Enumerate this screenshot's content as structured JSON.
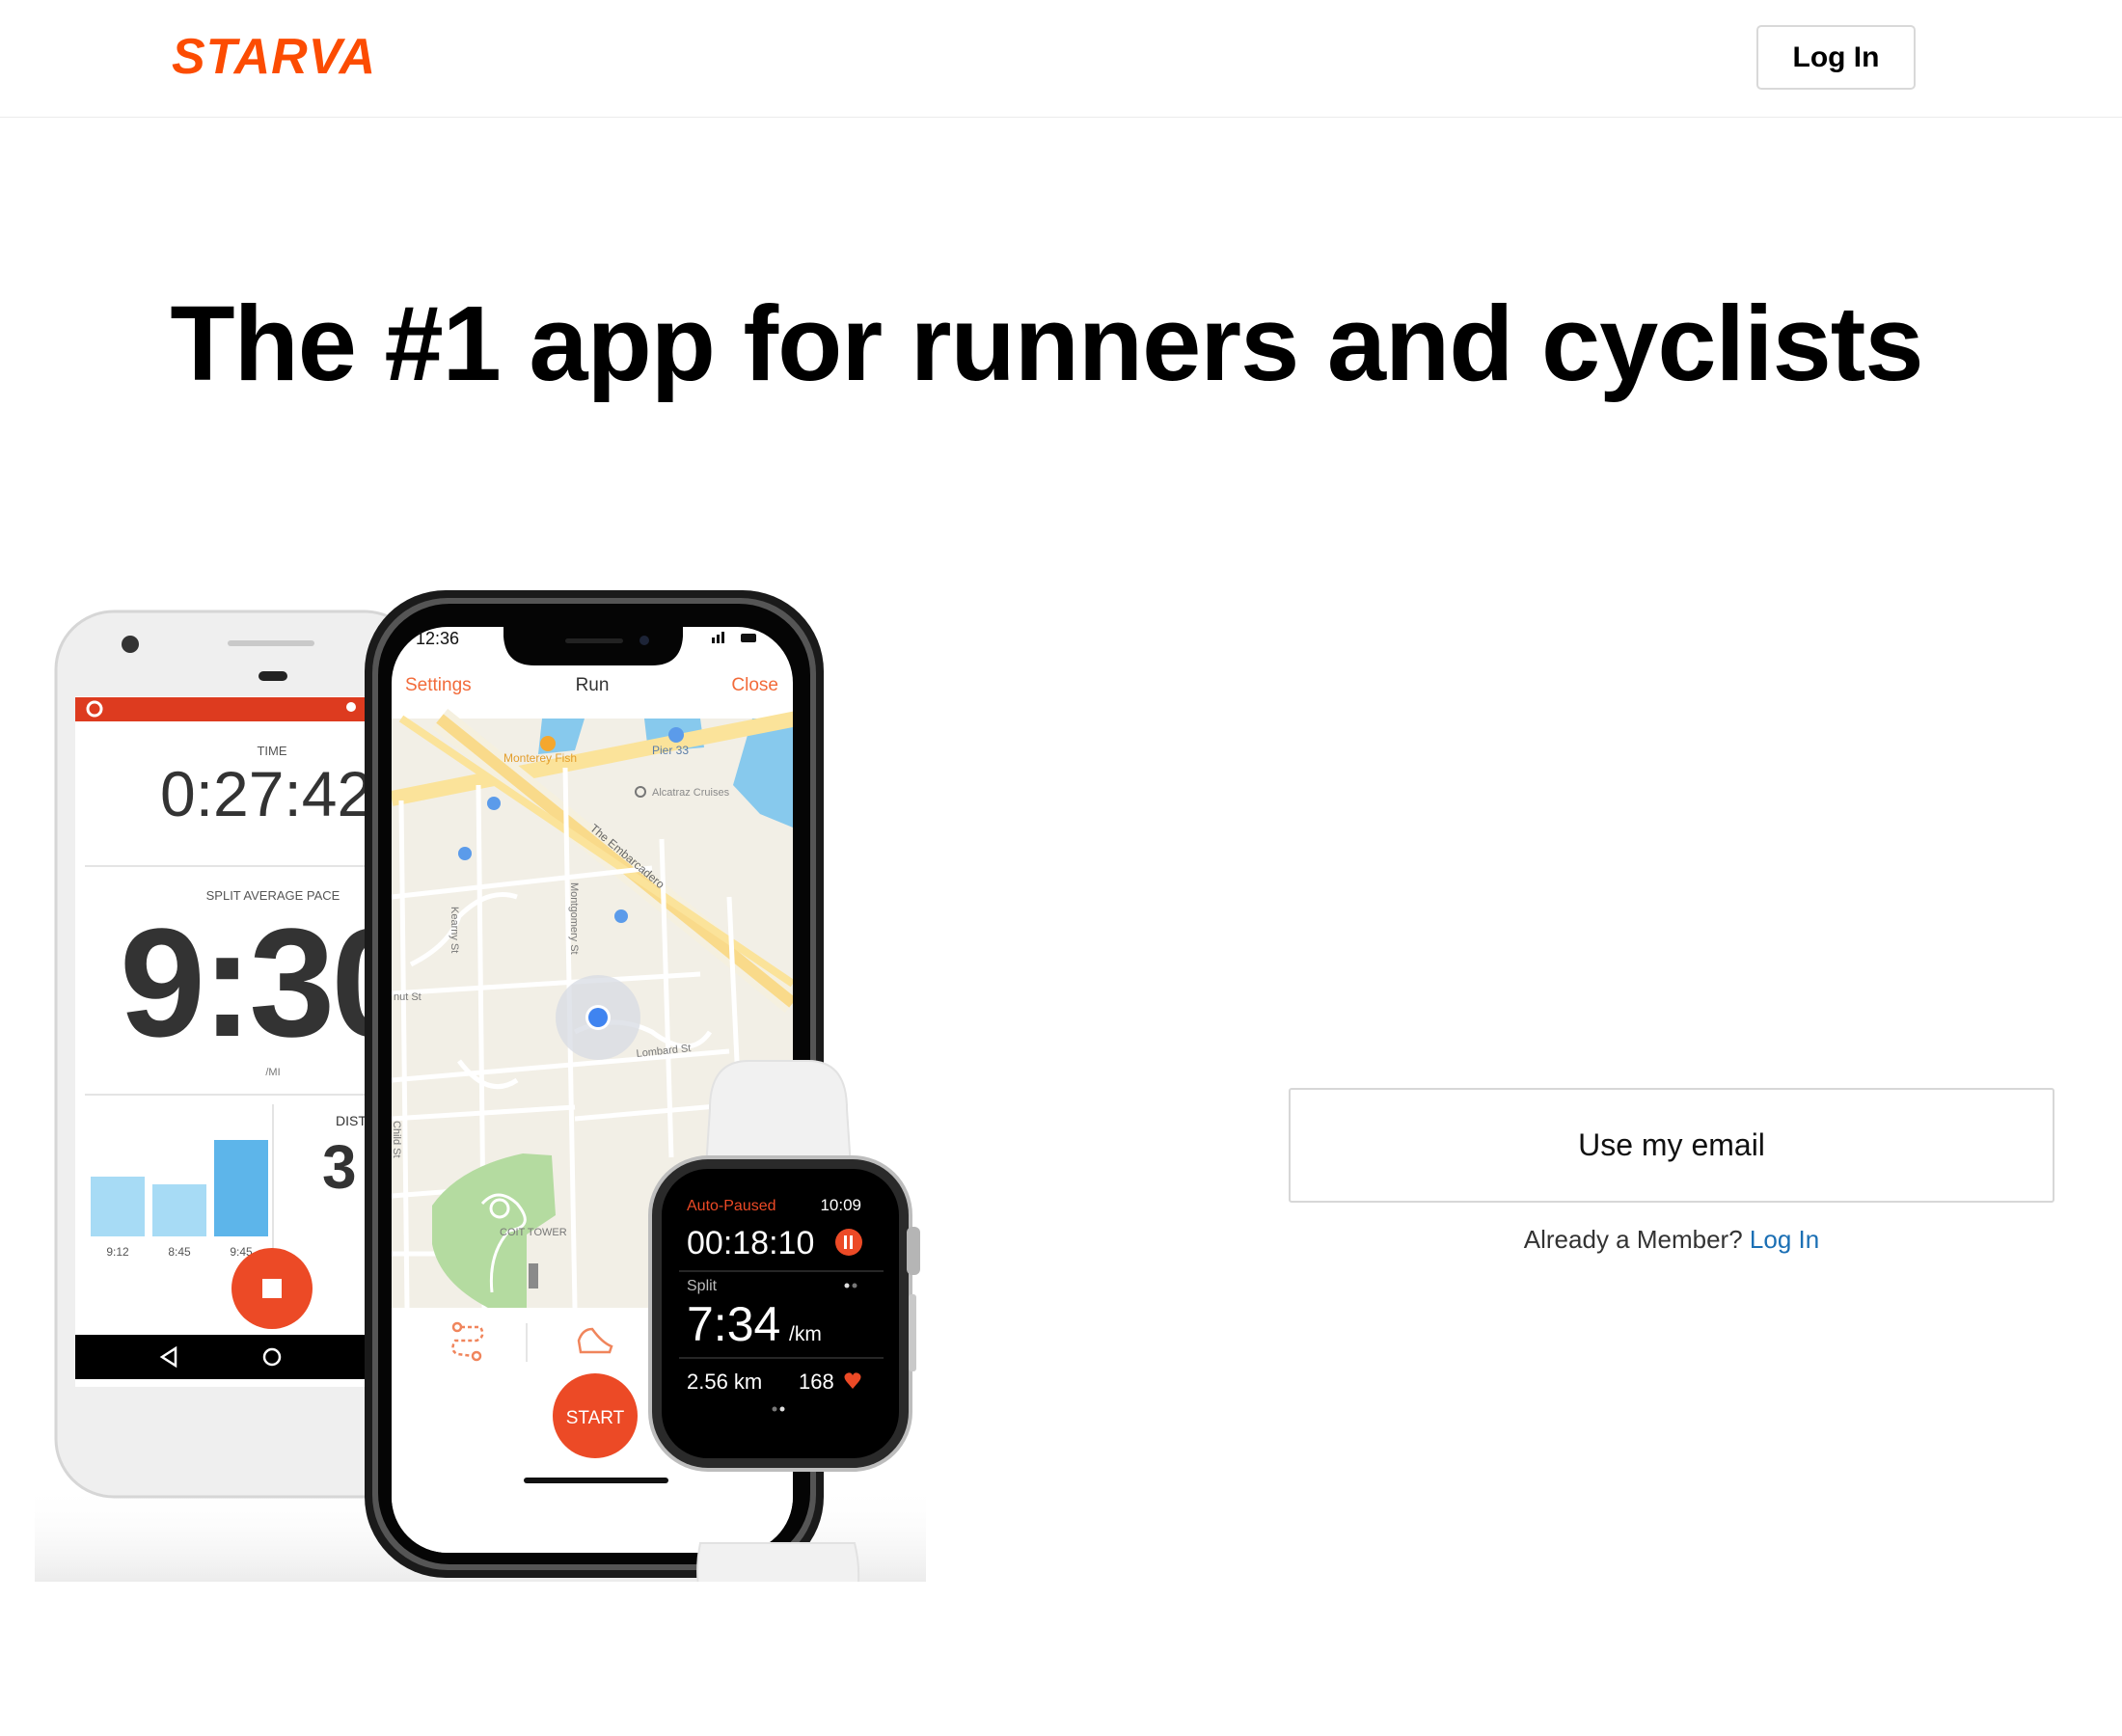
{
  "header": {
    "logo_text": "STARVA",
    "login_label": "Log In"
  },
  "hero": {
    "headline": "The #1 app for runners and cyclists"
  },
  "android_phone": {
    "time_label": "TIME",
    "time_value": "0:27:42",
    "pace_label": "SPLIT AVERAGE PACE",
    "pace_value": "9:30",
    "pace_unit": "/MI",
    "distance_label": "DIST",
    "distance_value": "3",
    "split_bars": [
      {
        "label": "9:12",
        "value": 0.62
      },
      {
        "label": "8:45",
        "value": 0.54
      },
      {
        "label": "9:45",
        "value": 1.0
      }
    ]
  },
  "iphone": {
    "status_time": "12:36",
    "nav_left": "Settings",
    "nav_title": "Run",
    "nav_right": "Close",
    "map_labels": {
      "monterey": "Monterey Fish",
      "pier": "Pier 33",
      "alcatraz": "Alcatraz Cruises",
      "embarcadero": "The Embarcadero",
      "montgomery": "Montgomery St",
      "kearny": "Kearny St",
      "walnut": "nut St",
      "lombard": "Lombard St",
      "coit": "COIT TOWER",
      "child": "Child St"
    },
    "start_label": "START"
  },
  "watch": {
    "status": "Auto-Paused",
    "clock": "10:09",
    "elapsed": "00:18:10",
    "split_label": "Split",
    "split_value": "7:34",
    "split_unit": "/km",
    "distance": "2.56 km",
    "heart_rate": "168"
  },
  "signup": {
    "email_button": "Use my email",
    "member_prompt": "Already a Member?",
    "member_login": "Log In"
  },
  "colors": {
    "brand": "#fc4c02",
    "link": "#1b6fb4",
    "bar": "#5db5ea",
    "bar_light": "#a7dbf5"
  }
}
